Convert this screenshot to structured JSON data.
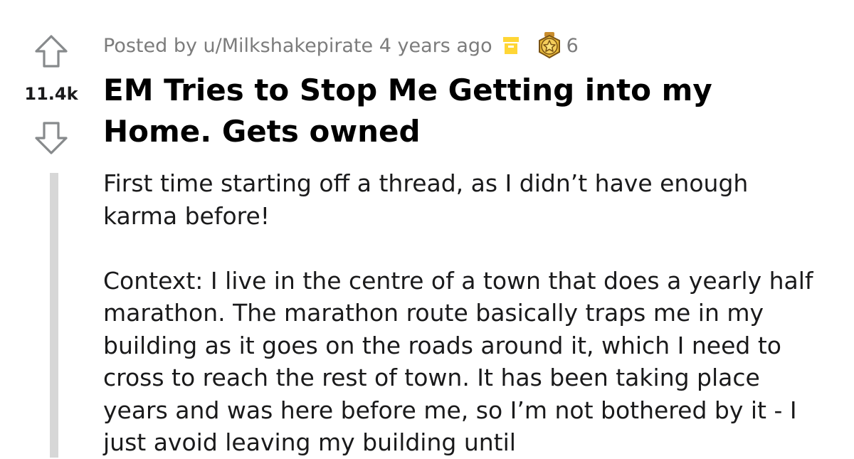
{
  "post": {
    "score": "11.4k",
    "meta": {
      "posted_by": "Posted by u/Milkshakepirate 4 years ago",
      "award_count": "6"
    },
    "title": "EM Tries to Stop Me Getting into my Home. Gets owned",
    "body": [
      "First time starting off a thread, as I didn’t have enough karma before!",
      "Context: I live in the centre of a town that does a yearly half marathon. The marathon route basically traps me in my building as it goes on the roads around it, which I need to cross to reach the rest of town. It has been taking place years and was here before me, so I’m not bothered by it - I just avoid leaving my building until"
    ]
  },
  "icons": {
    "upvote": "upvote-arrow-icon",
    "downvote": "downvote-arrow-icon",
    "archive": "archived-box-icon",
    "award": "award-medal-icon"
  },
  "colors": {
    "vote_icon": "#878a8c",
    "archive_icon": "#ffd635",
    "award_gold": "#e8b93a",
    "meta_text": "#7c7c7c",
    "thread_line": "#d7d7d7"
  }
}
